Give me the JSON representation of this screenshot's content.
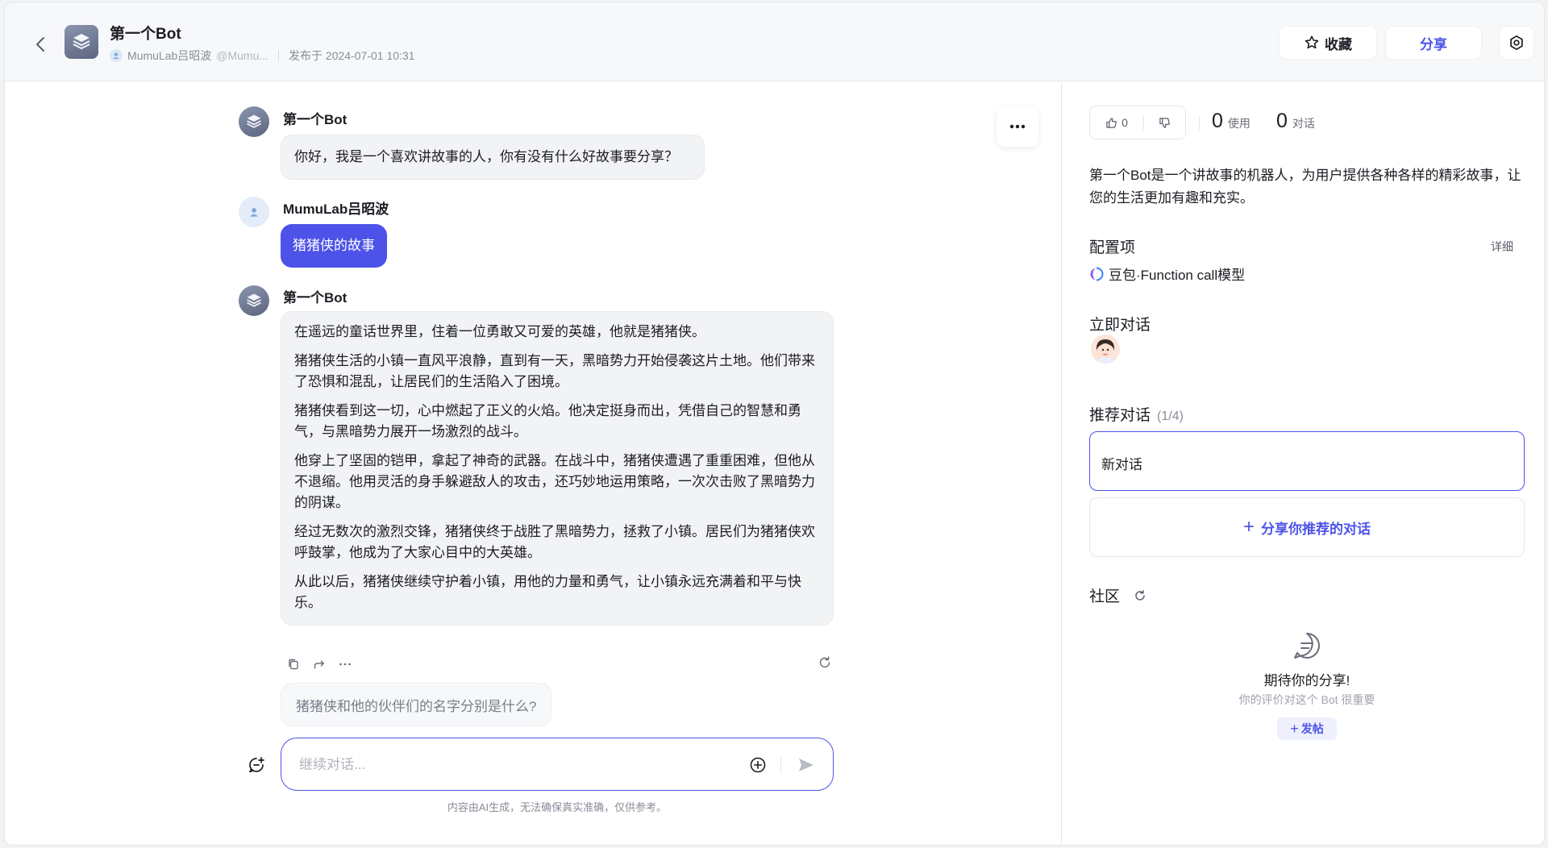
{
  "header": {
    "title": "第一个Bot",
    "author": "MumuLab吕昭波",
    "handle": "@Mumu...",
    "published": "发布于 2024-07-01 10:31",
    "favorite_label": "收藏",
    "share_label": "分享"
  },
  "chat": {
    "bot_name": "第一个Bot",
    "user_name": "MumuLab吕昭波",
    "greeting": "你好，我是一个喜欢讲故事的人，你有没有什么好故事要分享？",
    "user_message": "猪猪侠的故事",
    "story_paragraphs": [
      "在遥远的童话世界里，住着一位勇敢又可爱的英雄，他就是猪猪侠。",
      "猪猪侠生活的小镇一直风平浪静，直到有一天，黑暗势力开始侵袭这片土地。他们带来了恐惧和混乱，让居民们的生活陷入了困境。",
      "猪猪侠看到这一切，心中燃起了正义的火焰。他决定挺身而出，凭借自己的智慧和勇气，与黑暗势力展开一场激烈的战斗。",
      "他穿上了坚固的铠甲，拿起了神奇的武器。在战斗中，猪猪侠遭遇了重重困难，但他从不退缩。他用灵活的身手躲避敌人的攻击，还巧妙地运用策略，一次次击败了黑暗势力的阴谋。",
      "经过无数次的激烈交锋，猪猪侠终于战胜了黑暗势力，拯救了小镇。居民们为猪猪侠欢呼鼓掌，他成为了大家心目中的大英雄。",
      "从此以后，猪猪侠继续守护着小镇，用他的力量和勇气，让小镇永远充满着和平与快乐。"
    ],
    "suggestion": "猪猪侠和他的伙伴们的名字分别是什么?",
    "input_placeholder": "继续对话...",
    "disclaimer": "内容由AI生成，无法确保真实准确，仅供参考。"
  },
  "panel": {
    "like_count": "0",
    "usage_count": "0",
    "usage_label": "使用",
    "conversation_count": "0",
    "conversation_label": "对话",
    "description": "第一个Bot是一个讲故事的机器人，为用户提供各种各样的精彩故事，让您的生活更加有趣和充实。",
    "config_title": "配置项",
    "detail_link": "详细",
    "model_name": "豆包·Function call模型",
    "instant_chat_title": "立即对话",
    "recommended_title": "推荐对话",
    "recommended_count": "(1/4)",
    "recommended_item": "新对话",
    "share_recommended": "分享你推荐的对话",
    "community_title": "社区",
    "empty_title": "期待你的分享!",
    "empty_subtitle": "你的评价对这个 Bot 很重要",
    "post_label": "发帖"
  },
  "colors": {
    "accent": "#4d53e8",
    "user_bubble": "#4d53e8",
    "bot_bubble": "#f2f3f5",
    "page_bg": "#f2f3f5"
  },
  "icons": [
    "back-icon",
    "bot-stack-icon",
    "user-icon",
    "star-icon",
    "gear-icon",
    "more-icon",
    "copy-icon",
    "forward-icon",
    "ellipsis-icon",
    "regenerate-icon",
    "new-chat-icon",
    "add-circle-icon",
    "send-icon",
    "thumbs-up-icon",
    "thumbs-down-icon",
    "model-icon",
    "refresh-icon",
    "chat-bubble-icon"
  ]
}
